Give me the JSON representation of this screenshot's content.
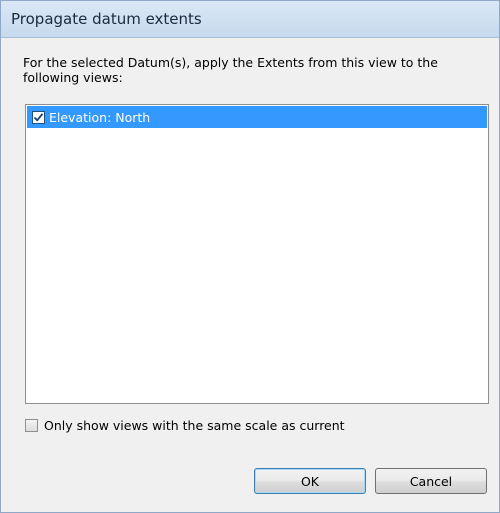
{
  "window": {
    "title": "Propagate datum extents"
  },
  "description": {
    "line1": "For the selected Datum(s), apply the Extents from this view to the",
    "line2": "following views:"
  },
  "views_list": {
    "items": [
      {
        "label": "Elevation: North",
        "checked": true,
        "selected": true
      }
    ]
  },
  "filter": {
    "label": "Only show views with the same scale as current",
    "checked": false
  },
  "buttons": {
    "ok_label": "OK",
    "cancel_label": "Cancel"
  },
  "colors": {
    "selection": "#3399ff",
    "title_bar": "#c6d9ee"
  }
}
